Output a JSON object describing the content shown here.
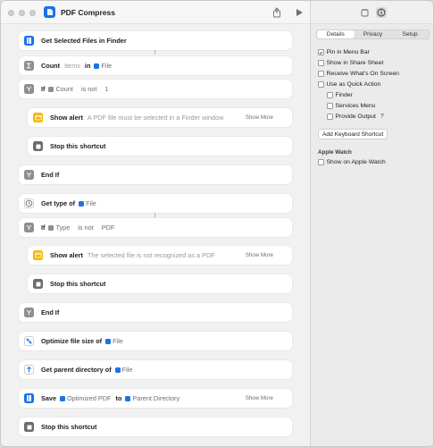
{
  "window": {
    "title": "PDF Compress"
  },
  "actions": [
    {
      "label": "Get Selected Files in Finder"
    },
    {
      "label": "Count",
      "muted": "Items",
      "in": "in",
      "token": "File"
    },
    {
      "label": "If",
      "token": "Count",
      "condition": "is not",
      "value": "1"
    },
    {
      "label": "Show alert",
      "muted": "A PDF file must be selected in a Finder window",
      "show_more": "Show More"
    },
    {
      "label": "Stop this shortcut"
    },
    {
      "label": "End If"
    },
    {
      "label": "Get type of",
      "token": "File"
    },
    {
      "label": "If",
      "token": "Type",
      "condition": "is not",
      "value": "PDF"
    },
    {
      "label": "Show alert",
      "muted": "The selected file is not recognized as a PDF",
      "show_more": "Show More"
    },
    {
      "label": "Stop this shortcut"
    },
    {
      "label": "End If"
    },
    {
      "label": "Optimize file size of",
      "token": "File"
    },
    {
      "label": "Get parent directory of",
      "token": "File"
    },
    {
      "label": "Save",
      "token": "Optimized PDF",
      "to": "to",
      "token2": "Parent Directory",
      "show_more": "Show More"
    },
    {
      "label": "Stop this shortcut"
    }
  ],
  "inspector": {
    "tabs": [
      "Details",
      "Privacy",
      "Setup"
    ],
    "selected_tab": "Details",
    "options": [
      {
        "label": "Pin in Menu Bar",
        "checked": true
      },
      {
        "label": "Show in Share Sheet",
        "checked": false
      },
      {
        "label": "Receive What's On Screen",
        "checked": false
      },
      {
        "label": "Use as Quick Action",
        "checked": false
      },
      {
        "label": "Finder",
        "checked": false
      },
      {
        "label": "Services Menu",
        "checked": false
      },
      {
        "label": "Provide Output",
        "checked": false,
        "help": "?"
      }
    ],
    "keyboard_shortcut_button": "Add Keyboard Shortcut",
    "apple_watch": {
      "heading": "Apple Watch",
      "option": {
        "label": "Show on Apple Watch",
        "checked": false
      }
    }
  },
  "icons": {
    "finder": "finder-icon",
    "count": "sigma-icon",
    "if": "branch-icon",
    "alert": "alert-icon",
    "stop": "stop-icon",
    "type": "file-type-icon",
    "optimize": "compress-icon",
    "parent": "arrow-up-icon",
    "save": "save-icon",
    "share": "share-icon",
    "play": "play-icon",
    "info": "info-icon",
    "library": "library-icon"
  },
  "colors": {
    "finder_blue": "#1a73e8",
    "alert_yellow": "#f5b800",
    "stop_gray": "#6b6b70",
    "logic_gray": "#8e8e93"
  }
}
